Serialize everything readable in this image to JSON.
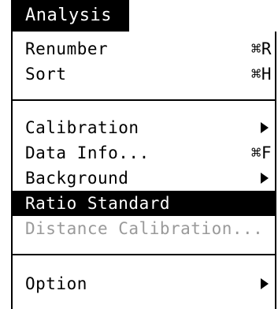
{
  "menu": {
    "title": "Analysis",
    "items": [
      {
        "label": "Renumber",
        "shortcut": "⌘R"
      },
      {
        "label": "Sort",
        "shortcut": "⌘H"
      },
      {
        "label": "Calibration",
        "submenu": true
      },
      {
        "label": "Data Info...",
        "shortcut": "⌘F"
      },
      {
        "label": "Background",
        "submenu": true
      },
      {
        "label": "Ratio Standard",
        "state": "highlighted"
      },
      {
        "label": "Distance Calibration...",
        "state": "disabled"
      },
      {
        "label": "Option",
        "submenu": true
      }
    ]
  },
  "colors": {
    "highlight_bg": "#000000",
    "highlight_fg": "#ffffff",
    "disabled_fg": "#9a9a9a"
  }
}
